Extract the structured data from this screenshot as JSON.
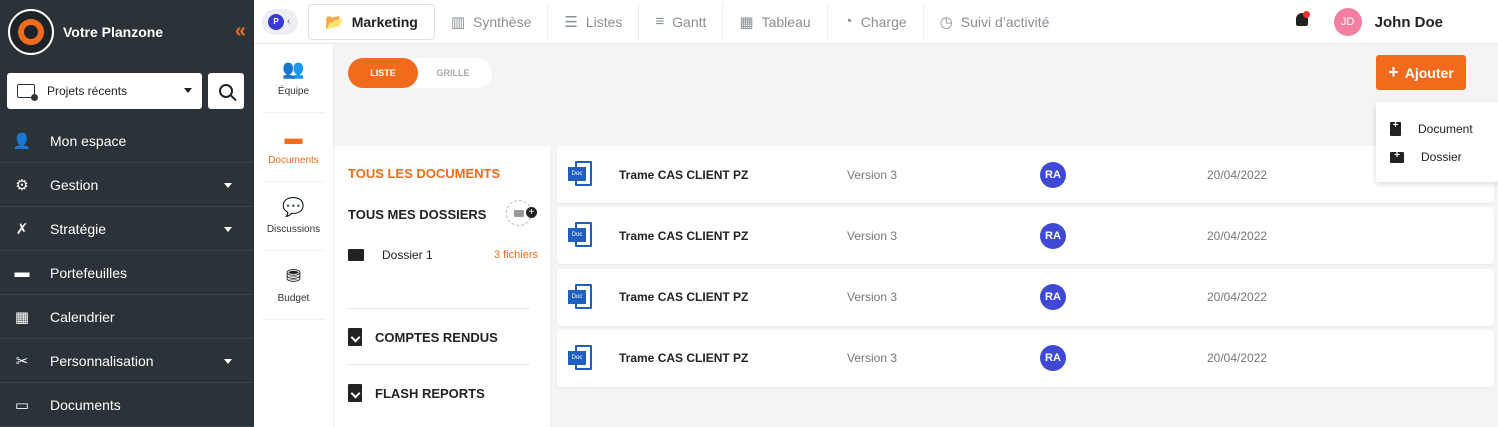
{
  "sidebar": {
    "brand": "Votre Planzone",
    "collapse_glyph": "«",
    "recent_projects": "Projets récents",
    "items": [
      {
        "label": "Mon espace",
        "icon": "user-lock-icon",
        "glyph": "👤",
        "dropdown": false
      },
      {
        "label": "Gestion",
        "icon": "users-cog-icon",
        "glyph": "⚙",
        "dropdown": true
      },
      {
        "label": "Stratégie",
        "icon": "strategy-icon",
        "glyph": "✗",
        "dropdown": true
      },
      {
        "label": "Portefeuilles",
        "icon": "wallet-icon",
        "glyph": "▬",
        "dropdown": false
      },
      {
        "label": "Calendrier",
        "icon": "calendar-icon",
        "glyph": "▦",
        "dropdown": false
      },
      {
        "label": "Personnalisation",
        "icon": "tools-icon",
        "glyph": "✂",
        "dropdown": true
      },
      {
        "label": "Documents",
        "icon": "laptop-icon",
        "glyph": "▭",
        "dropdown": false
      }
    ]
  },
  "topbar": {
    "project_initial": "P",
    "project_back": "‹",
    "tabs": [
      {
        "label": "Marketing",
        "icon": "folder-open-icon",
        "glyph": "📂",
        "active": true
      },
      {
        "label": "Synthèse",
        "icon": "columns-icon",
        "glyph": "▥",
        "active": false
      },
      {
        "label": "Listes",
        "icon": "list-icon",
        "glyph": "☰",
        "active": false
      },
      {
        "label": "Gantt",
        "icon": "gantt-icon",
        "glyph": "≡",
        "active": false
      },
      {
        "label": "Tableau",
        "icon": "board-icon",
        "glyph": "▦",
        "active": false
      },
      {
        "label": "Charge",
        "icon": "gauge-icon",
        "glyph": "◔",
        "active": false
      },
      {
        "label": "Suivi d’activité",
        "icon": "clock-icon",
        "glyph": "◷",
        "active": false
      }
    ],
    "user_initials": "JD",
    "user_name": "John Doe"
  },
  "subnav": [
    {
      "label": "Équipe",
      "icon": "team-icon",
      "glyph": "👥",
      "active": false
    },
    {
      "label": "Documents",
      "icon": "documents-icon",
      "glyph": "▬",
      "active": true
    },
    {
      "label": "Discussions",
      "icon": "comments-icon",
      "glyph": "💬",
      "active": false
    },
    {
      "label": "Budget",
      "icon": "coins-icon",
      "glyph": "⛃",
      "active": false
    }
  ],
  "view_toggle": {
    "list": "LISTE",
    "grid": "GRILLE"
  },
  "add_button": {
    "plus": "+",
    "label": "Ajouter"
  },
  "add_menu": {
    "document": "Document",
    "folder": "Dossier"
  },
  "folders": {
    "all_documents": "TOUS LES DOCUMENTS",
    "my_folders": "TOUS MES DOSSIERS",
    "folder": {
      "name": "Dossier 1",
      "count": "3 fichiers"
    },
    "minutes": "COMPTES RENDUS",
    "flash_reports": "FLASH REPORTS"
  },
  "documents": [
    {
      "type": "Doc",
      "name": "Trame CAS CLIENT PZ",
      "version": "Version 3",
      "owner": "RA",
      "date": "20/04/2022"
    },
    {
      "type": "Doc",
      "name": "Trame CAS CLIENT PZ",
      "version": "Version 3",
      "owner": "RA",
      "date": "20/04/2022"
    },
    {
      "type": "Doc",
      "name": "Trame CAS CLIENT PZ",
      "version": "Version 3",
      "owner": "RA",
      "date": "20/04/2022"
    },
    {
      "type": "Doc",
      "name": "Trame CAS CLIENT PZ",
      "version": "Version 3",
      "owner": "RA",
      "date": "20/04/2022"
    }
  ],
  "colors": {
    "accent": "#f26b1d",
    "sidebar": "#2b3238",
    "owner_badge": "#3f49d6",
    "doc_blue": "#1f5fbf"
  }
}
